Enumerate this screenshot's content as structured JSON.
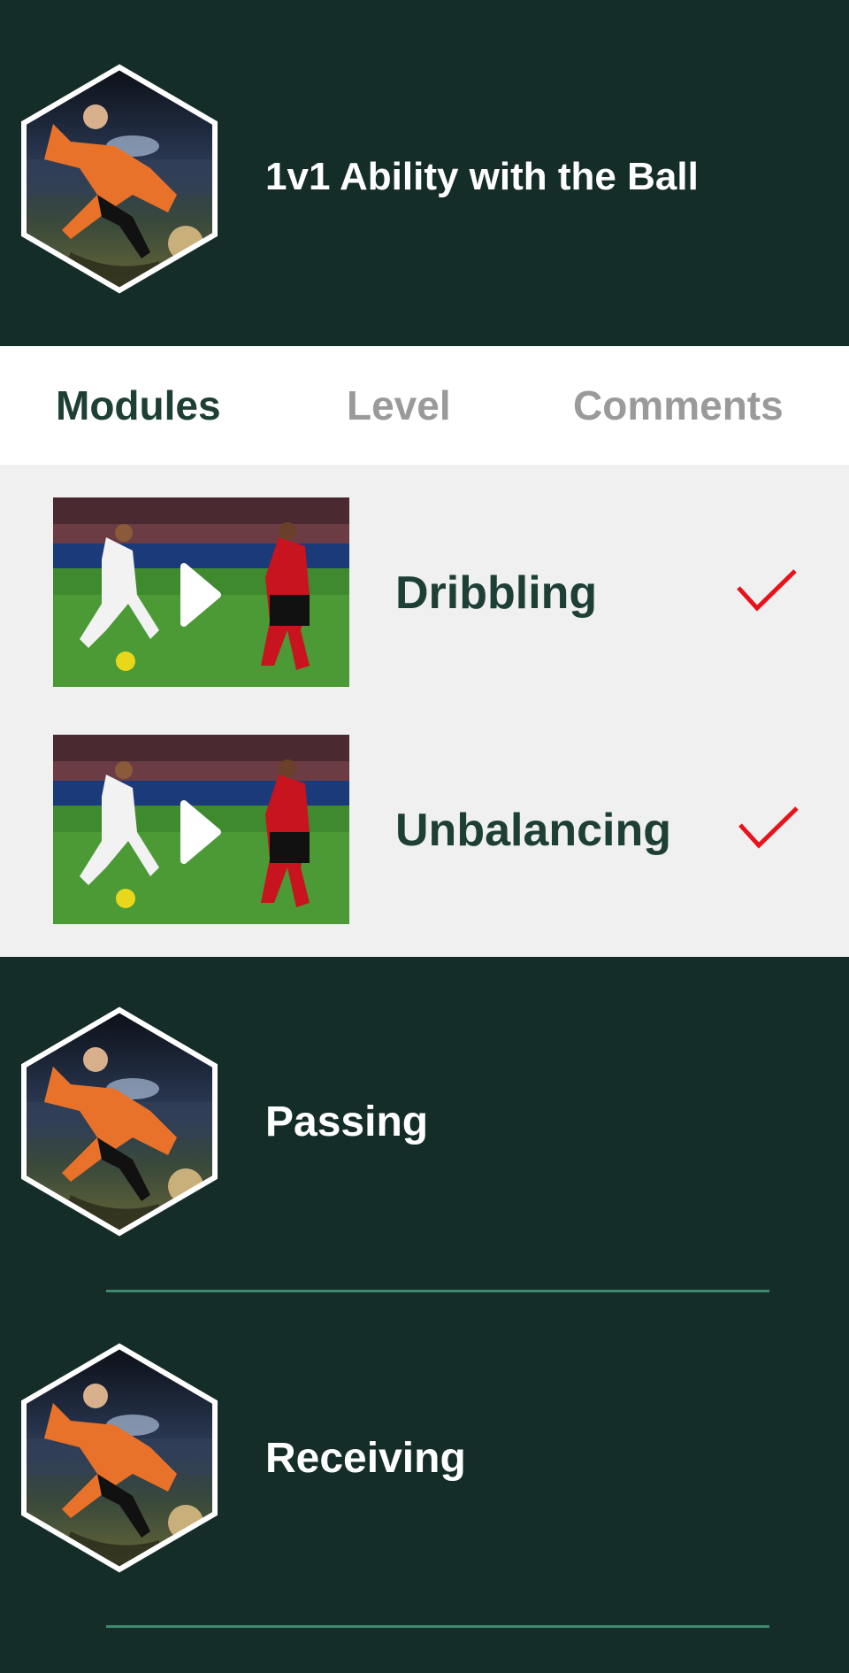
{
  "course": {
    "title": "1v1 Ability with the Ball"
  },
  "tabs": [
    {
      "label": "Modules",
      "active": true
    },
    {
      "label": "Level",
      "active": false
    },
    {
      "label": "Comments",
      "active": false
    }
  ],
  "modules": [
    {
      "label": "Dribbling",
      "completed": true,
      "icon": "play-icon"
    },
    {
      "label": "Unbalancing",
      "completed": true,
      "icon": "play-icon"
    }
  ],
  "sections": [
    {
      "label": "Passing"
    },
    {
      "label": "Receiving"
    }
  ],
  "colors": {
    "background": "#142d28",
    "accent": "#1e3f35",
    "check": "#e8121b",
    "divider": "#3c8a6e",
    "inactive_tab": "#9a9a9a"
  }
}
